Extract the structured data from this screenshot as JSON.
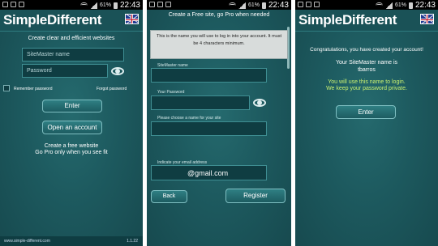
{
  "status_bars": [
    {
      "battery": "61%",
      "time": "22:43"
    },
    {
      "battery": "61%",
      "time": "22:43"
    },
    {
      "battery": "61%",
      "time": "22:43"
    }
  ],
  "app": {
    "brand": "SimpleDifferent"
  },
  "login": {
    "heading": "Create clear and efficient websites",
    "name_placeholder": "SiteMaster name",
    "password_placeholder": "Password",
    "remember_label": "Remember password",
    "forgot_label": "Forgot password",
    "enter_button": "Enter",
    "open_account_button": "Open an account",
    "promo_line1": "Create a free website",
    "promo_line2": "Go Pro only when you see fit",
    "footer_url": "www.simple-different.com",
    "version": "1.1.22"
  },
  "signup": {
    "title": "Create a Free site, go Pro when needed",
    "notice": "This is the name you will use to log in into your account. It must be 4 characters minimum.",
    "name_label": "SiteMaster name",
    "password_label": "Your Password",
    "site_label": "Please choose a name for your site",
    "email_label": "Indicate your email address",
    "email_value": "@gmail.com",
    "back_button": "Back",
    "register_button": "Register"
  },
  "success": {
    "congrats": "Congratulations, you have created your account!",
    "name_intro": "Your SiteMaster name is",
    "username": "tbarros",
    "hint_line1": "You will use this name to login.",
    "hint_line2": "We keep your password private.",
    "enter_button": "Enter"
  }
}
